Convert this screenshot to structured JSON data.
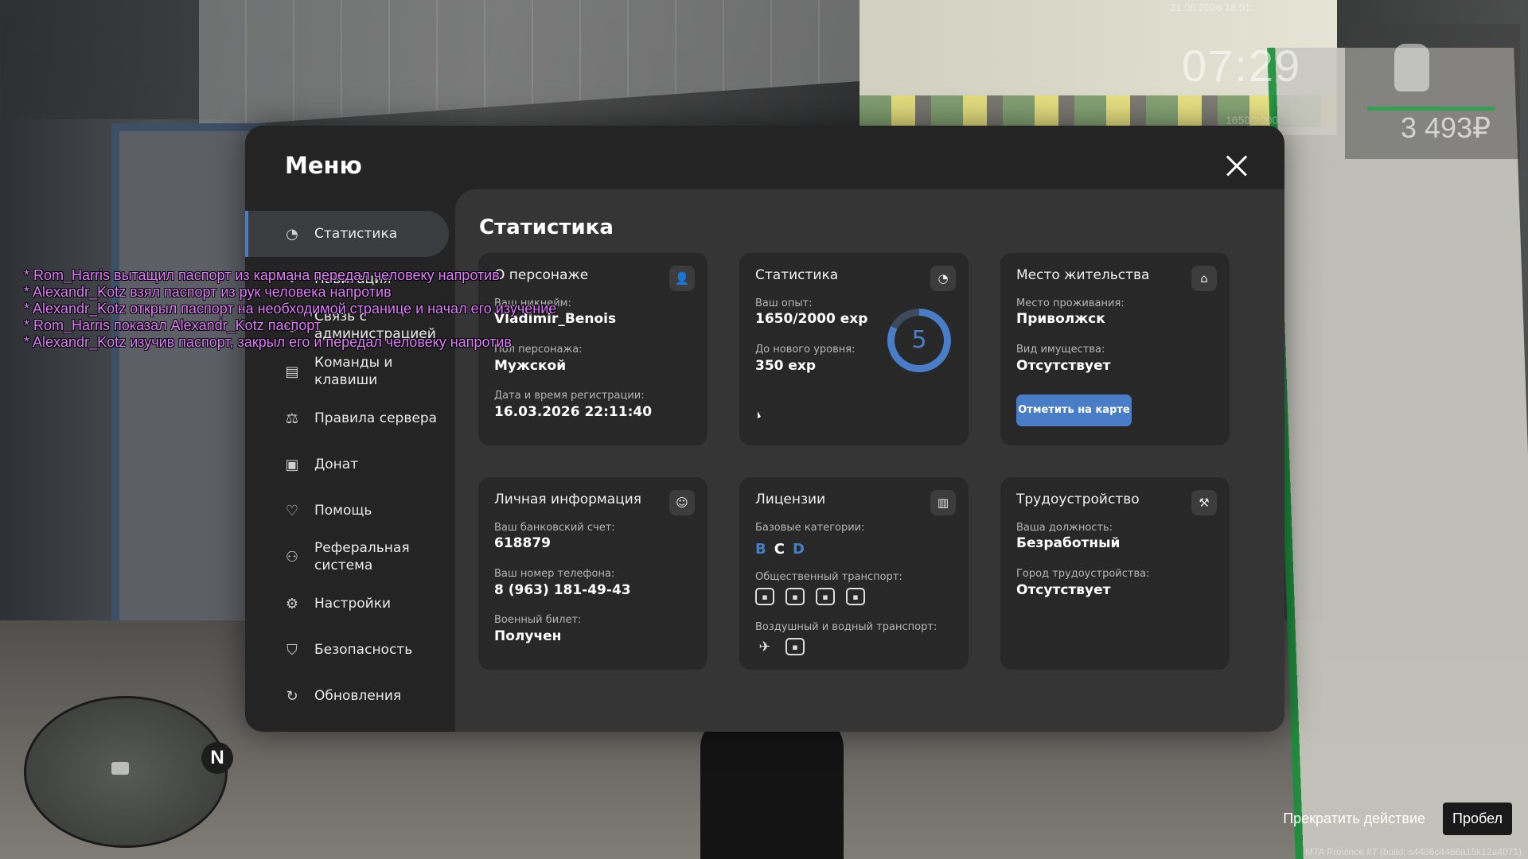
{
  "hud": {
    "date": "21.06.2026 18:01:",
    "clock": "07:29",
    "xp": "1650/2000",
    "money": "3 493₽"
  },
  "minimap": {
    "north": "N"
  },
  "chat": [
    "* Rom_Harris вытащил паспорт из кармана передал человеку напротив",
    "* Alexandr_Kotz взял паспорт из рук человека напротив",
    "* Alexandr_Kotz открыл паспорт на необходимой странице и начал его изучение",
    "* Rom_Harris показал Alexandr_Kotz паспорт",
    "* Alexandr_Kotz изучив паспорт, закрыл его и передал человеку напротив"
  ],
  "action_hint": {
    "label": "Прекратить действие",
    "key": "Пробел"
  },
  "build_info": "MTA Province #7 (build: s4486c4486a15k12a4071)",
  "menu": {
    "title": "Меню",
    "sidebar": [
      {
        "label": "Статистика",
        "icon": "chart-pie-icon",
        "active": true
      },
      {
        "label": "Навигация",
        "icon": "navigation-icon"
      },
      {
        "label": "Связь с администрацией",
        "icon": "support-icon"
      },
      {
        "label": "Команды и клавиши",
        "icon": "document-icon"
      },
      {
        "label": "Правила сервера",
        "icon": "scales-icon"
      },
      {
        "label": "Донат",
        "icon": "wallet-icon"
      },
      {
        "label": "Помощь",
        "icon": "hands-heart-icon"
      },
      {
        "label": "Реферальная система",
        "icon": "referral-icon"
      },
      {
        "label": "Настройки",
        "icon": "gear-icon"
      },
      {
        "label": "Безопасность",
        "icon": "shield-icon"
      },
      {
        "label": "Обновления",
        "icon": "refresh-icon"
      }
    ]
  },
  "content": {
    "title": "Статистика",
    "character": {
      "title": "О персонаже",
      "nickname_label": "Ваш никнейм:",
      "nickname": "Vladimir_Benois",
      "gender_label": "Пол персонажа:",
      "gender": "Мужской",
      "reg_label": "Дата и время регистрации:",
      "reg": "16.03.2026 22:11:40"
    },
    "stats": {
      "title": "Статистика",
      "xp_label": "Ваш опыт:",
      "xp": "1650/2000 exp",
      "next_label": "До нового уровня:",
      "next": "350 exp",
      "level": "5",
      "level_progress": 0.825
    },
    "residence": {
      "title": "Место жительства",
      "place_label": "Место проживания:",
      "place": "Приволжск",
      "property_label": "Вид имущества:",
      "property": "Отсутствует",
      "button": "Отметить на карте"
    },
    "personal": {
      "title": "Личная информация",
      "bank_label": "Ваш банковский счет:",
      "bank": "618879",
      "phone_label": "Ваш номер телефона:",
      "phone": "8 (963) 181-49-43",
      "military_label": "Военный билет:",
      "military": "Получен"
    },
    "licenses": {
      "title": "Лицензии",
      "base_label": "Базовые категории:",
      "categories": [
        "B",
        "C",
        "D"
      ],
      "public_label": "Общественный транспорт:",
      "air_label": "Воздушный и водный транспорт:"
    },
    "employment": {
      "title": "Трудоустройство",
      "job_label": "Ваша должность:",
      "job": "Безработный",
      "city_label": "Город трудоустройства:",
      "city": "Отсутствует"
    }
  }
}
